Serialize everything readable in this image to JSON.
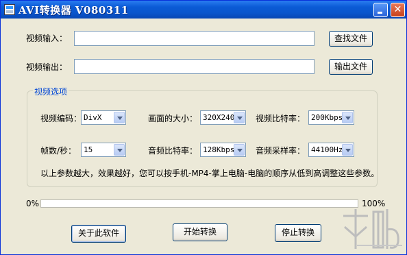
{
  "window": {
    "title": "AVI转换器 V080311",
    "close_glyph": "✕"
  },
  "io": {
    "input_label": "视频输入：",
    "input_value": "",
    "browse_button": "查找文件",
    "output_label": "视频输出：",
    "output_value": "",
    "output_button": "输出文件"
  },
  "options": {
    "legend": "视频选项",
    "video_codec": {
      "label": "视频编码：",
      "value": "DivX"
    },
    "frame_size": {
      "label": "画面的大小：",
      "value": "320X240"
    },
    "video_bitrate": {
      "label": "视频比特率：",
      "value": "200Kbps"
    },
    "fps": {
      "label": "帧数/秒：",
      "value": "15"
    },
    "audio_bitrate": {
      "label": "音频比特率：",
      "value": "128Kbps"
    },
    "audio_samplerate": {
      "label": "音频采样率：",
      "value": "44100Hz"
    },
    "note": "以上参数越大，效果越好，您可以按手机-MP4-掌上电脑-电脑的顺序从低到高调整这些参数。"
  },
  "progress": {
    "min_label": "0%",
    "max_label": "100%",
    "value": 0
  },
  "buttons": {
    "about": "关于此软件",
    "start": "开始转换",
    "stop": "停止转换"
  },
  "icons": {
    "app": "app-icon",
    "minimize": "minimize-icon",
    "close": "close-icon",
    "dropdown": "chevron-down-icon"
  }
}
